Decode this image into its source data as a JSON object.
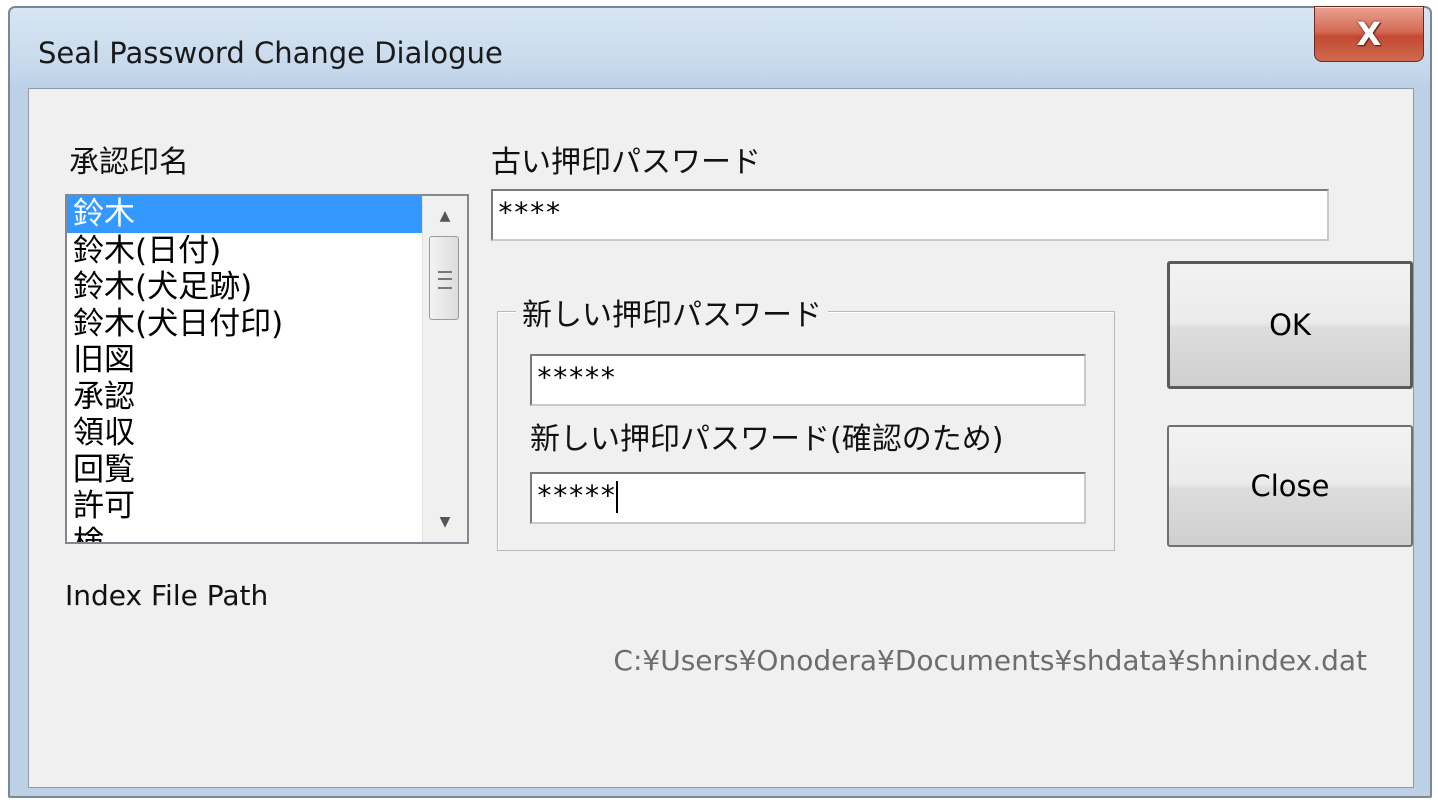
{
  "window": {
    "title": "Seal Password Change Dialogue",
    "close_glyph": "X"
  },
  "labels": {
    "seal_name": "承認印名",
    "old_password": "古い押印パスワード",
    "new_password_group": "新しい押印パスワード",
    "confirm_password": "新しい押印パスワード(確認のため)",
    "index_file_path": "Index File Path"
  },
  "seal_list": {
    "items": [
      "鈴木",
      "鈴木(日付)",
      "鈴木(犬足跡)",
      "鈴木(犬日付印)",
      "旧図",
      "承認",
      "領収",
      "回覧",
      "許可",
      "検"
    ],
    "selected": "鈴木"
  },
  "fields": {
    "old_password": "****",
    "new_password": "*****",
    "confirm_password": "*****"
  },
  "buttons": {
    "ok": "OK",
    "close": "Close"
  },
  "index_path": "C:¥Users¥Onodera¥Documents¥shdata¥shnindex.dat",
  "colors": {
    "selection": "#3399ff",
    "dialog_bg": "#f0f0f0",
    "close_button": "#c24a33"
  }
}
